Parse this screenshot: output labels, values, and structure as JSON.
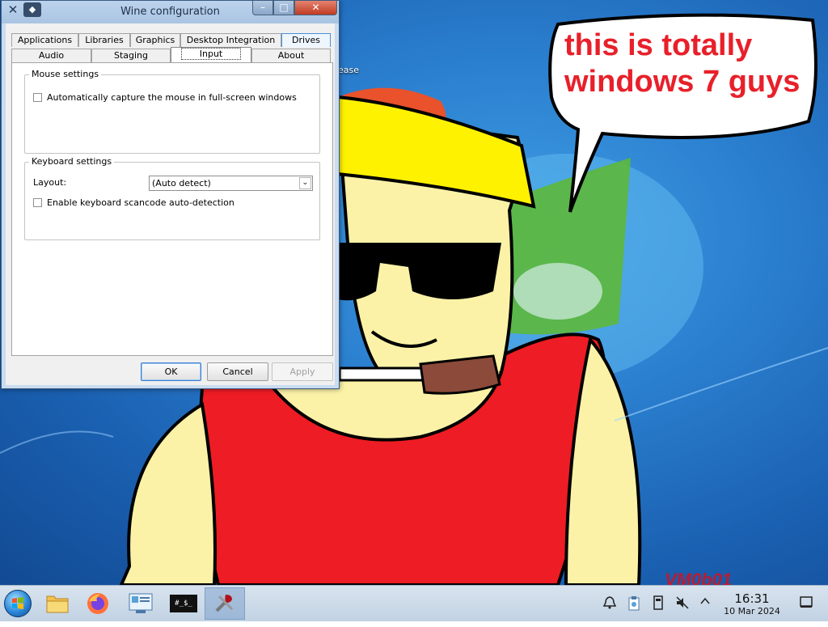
{
  "desktop": {
    "speech_bubble": [
      "this is totally",
      "windows 7 guys"
    ],
    "icon_label_fragment": "ease",
    "watermark": "VM0b01"
  },
  "window": {
    "title": "Wine configuration",
    "controls": {
      "minimize": "–",
      "maximize": "□",
      "close": "✕"
    },
    "tabs_row1": [
      "Applications",
      "Libraries",
      "Graphics",
      "Desktop Integration",
      "Drives"
    ],
    "tabs_row2": [
      "Audio",
      "Staging",
      "Input",
      "About"
    ],
    "selected_tab": "Input",
    "mouse_group": {
      "title": "Mouse settings",
      "capture_label": "Automatically capture the mouse in full-screen windows",
      "capture_checked": false
    },
    "keyboard_group": {
      "title": "Keyboard settings",
      "layout_label": "Layout:",
      "layout_value": "(Auto detect)",
      "scancode_label": "Enable keyboard scancode auto-detection",
      "scancode_checked": false
    },
    "buttons": {
      "ok": "OK",
      "cancel": "Cancel",
      "apply": "Apply"
    }
  },
  "taskbar": {
    "apps": [
      "file-manager-icon",
      "firefox-icon",
      "control-panel-icon",
      "terminal-icon",
      "wine-config-icon"
    ],
    "terminal_text": "#_$_",
    "clock": {
      "time": "16:31",
      "date": "10 Mar 2024"
    }
  },
  "colors": {
    "accent": "#3c7fd1",
    "bubble_text": "#e8202a",
    "taskbar": "#c8d6e6"
  }
}
